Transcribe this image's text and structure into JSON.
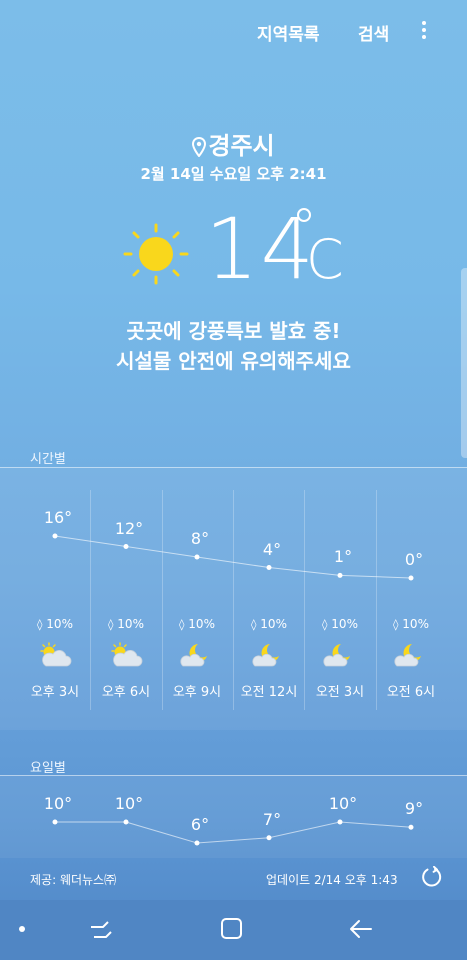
{
  "topbar": {
    "regions_label": "지역목록",
    "search_label": "검색"
  },
  "location": {
    "city": "경주시"
  },
  "datetime": "2월 14일 수요일 오후 2:41",
  "current": {
    "temp": "14",
    "unit": "C",
    "condition_icon": "sun-icon"
  },
  "alert": {
    "line1": "곳곳에 강풍특보 발효 중!",
    "line2": "시설물 안전에 유의해주세요"
  },
  "hourly": {
    "section_label": "시간별",
    "items": [
      {
        "temp": "16°",
        "temp_value": 16,
        "precip": "10%",
        "icon": "partly-cloudy-sun-icon",
        "time": "오후 3시"
      },
      {
        "temp": "12°",
        "temp_value": 12,
        "precip": "10%",
        "icon": "partly-cloudy-sun-icon",
        "time": "오후 6시"
      },
      {
        "temp": "8°",
        "temp_value": 8,
        "precip": "10%",
        "icon": "moon-cloud-icon",
        "time": "오후 9시"
      },
      {
        "temp": "4°",
        "temp_value": 4,
        "precip": "10%",
        "icon": "moon-cloud-icon",
        "time": "오전 12시"
      },
      {
        "temp": "1°",
        "temp_value": 1,
        "precip": "10%",
        "icon": "moon-cloud-icon",
        "time": "오전 3시"
      },
      {
        "temp": "0°",
        "temp_value": 0,
        "precip": "10%",
        "icon": "moon-cloud-icon",
        "time": "오전 6시"
      }
    ]
  },
  "daily": {
    "section_label": "요일별",
    "items": [
      {
        "temp": "10°",
        "temp_value": 10
      },
      {
        "temp": "10°",
        "temp_value": 10
      },
      {
        "temp": "6°",
        "temp_value": 6
      },
      {
        "temp": "7°",
        "temp_value": 7
      },
      {
        "temp": "10°",
        "temp_value": 10
      },
      {
        "temp": "9°",
        "temp_value": 9
      }
    ]
  },
  "footer": {
    "provider": "제공: 웨더뉴스㈜",
    "updated": "업데이트  2/14  오후 1:43"
  },
  "colors": {
    "background_top": "#7cbde9",
    "background_bottom": "#4f86c6",
    "sun": "#f9d71c",
    "navbar": "#5086c4"
  }
}
